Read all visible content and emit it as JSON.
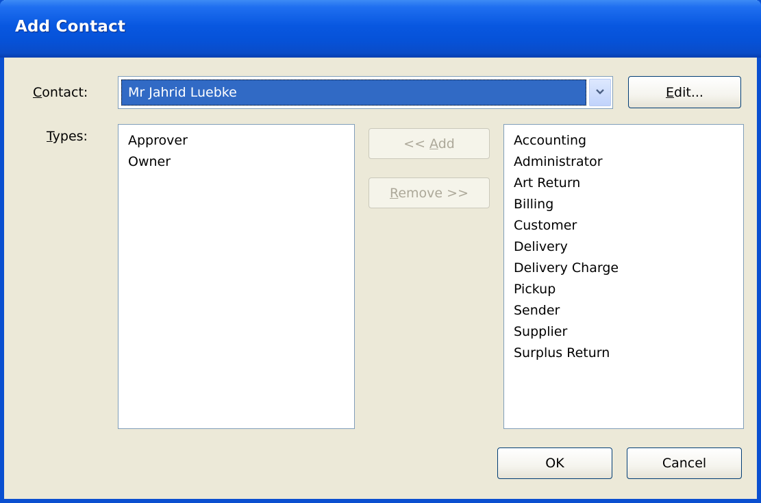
{
  "window": {
    "title": "Add Contact"
  },
  "contact": {
    "label": "Contact:",
    "value": "Mr Jahrid Luebke",
    "edit_label": "Edit..."
  },
  "types": {
    "label": "Types:",
    "assigned": [
      "Approver",
      "Owner"
    ],
    "available": [
      "Accounting",
      "Administrator",
      "Art Return",
      "Billing",
      "Customer",
      "Delivery",
      "Delivery Charge",
      "Pickup",
      "Sender",
      "Supplier",
      "Surplus Return"
    ],
    "add_label": "<< Add",
    "remove_label": "Remove >>"
  },
  "footer": {
    "ok_label": "OK",
    "cancel_label": "Cancel"
  },
  "colors": {
    "titlebar": "#0857e0",
    "selection": "#316ac5",
    "face": "#ece9d8"
  }
}
